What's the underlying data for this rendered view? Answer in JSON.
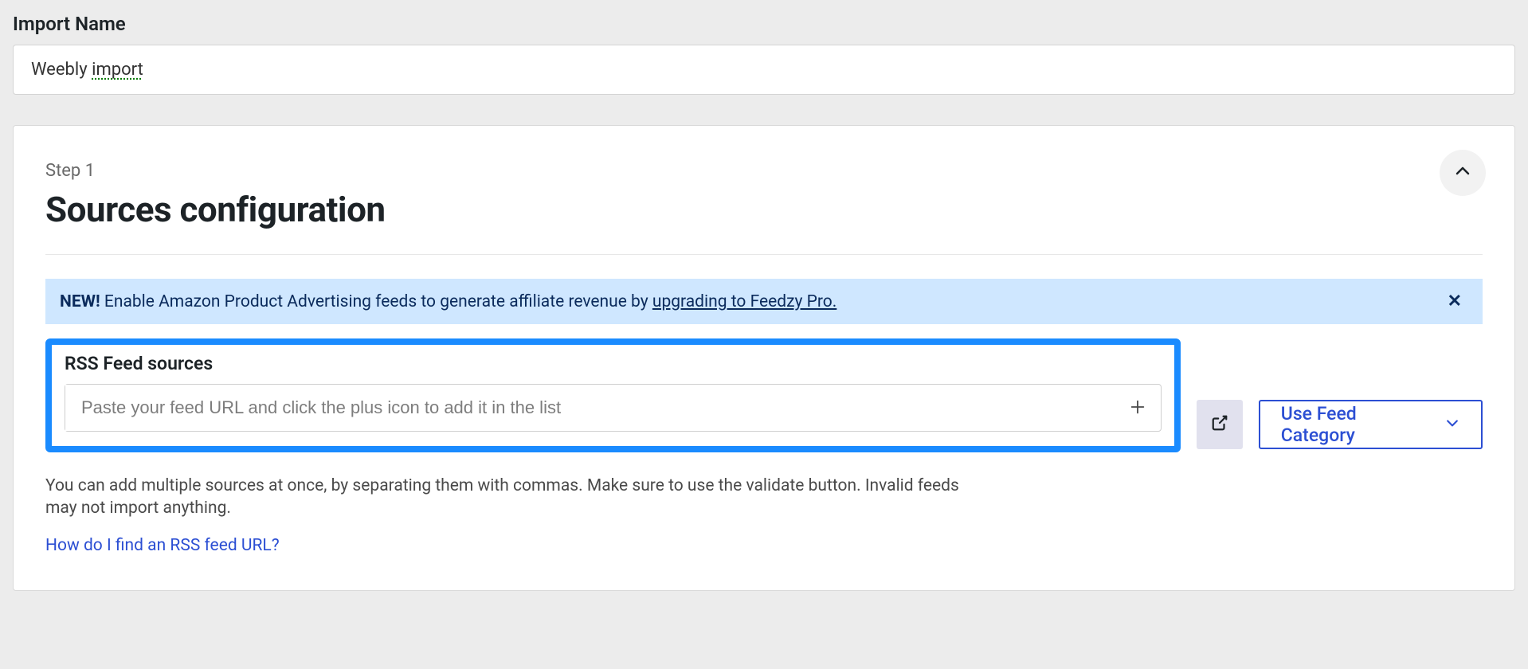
{
  "import": {
    "label": "Import Name",
    "value_prefix": "Weebly ",
    "value_suffix": "import"
  },
  "step": {
    "tag": "Step 1",
    "title": "Sources configuration"
  },
  "notice": {
    "prefix": "NEW! ",
    "body": "Enable Amazon Product Advertising feeds to generate affiliate revenue by ",
    "link_text": "upgrading to Feedzy Pro."
  },
  "sources": {
    "label": "RSS Feed sources",
    "placeholder": "Paste your feed URL and click the plus icon to add it in the list",
    "value": ""
  },
  "feed_category_btn": "Use Feed Category",
  "help_text": "You can add multiple sources at once, by separating them with commas. Make sure to use the validate button. Invalid feeds may not import anything.",
  "help_link": "How do I find an RSS feed URL?",
  "colors": {
    "highlight": "#1a8bff",
    "notice_bg": "#cfe7ff",
    "accent": "#2c4fd3"
  }
}
